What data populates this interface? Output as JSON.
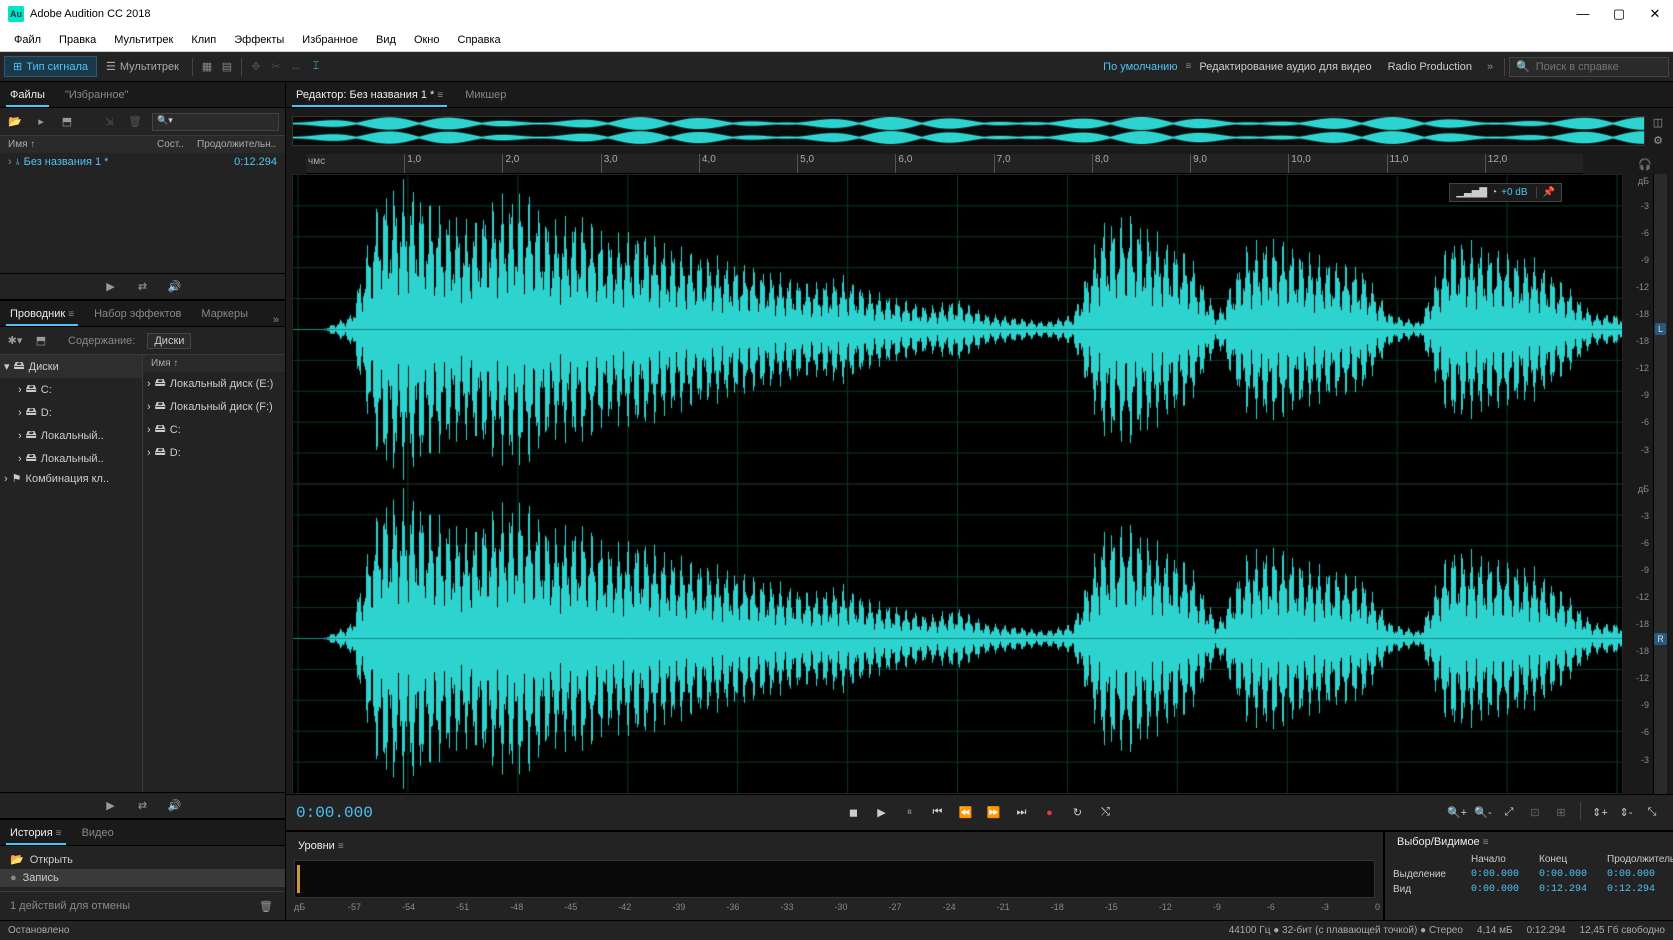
{
  "app": {
    "title": "Adobe Audition CC 2018",
    "icon_text": "Au"
  },
  "menu": [
    "Файл",
    "Правка",
    "Мультитрек",
    "Клип",
    "Эффекты",
    "Избранное",
    "Вид",
    "Окно",
    "Справка"
  ],
  "toolbar": {
    "mode_waveform": "Тип сигнала",
    "mode_multitrack": "Мультитрек",
    "workspace_default": "По умолчанию",
    "workspace_audio_video": "Редактирование аудио для видео",
    "workspace_radio": "Radio Production",
    "search_placeholder": "Поиск в справке"
  },
  "files_panel": {
    "tab_files": "Файлы",
    "tab_fav": "\"Избранное\"",
    "col_name": "Имя ↑",
    "col_state": "Сост..",
    "col_duration": "Продолжительн..",
    "file_name": "Без названия 1 *",
    "file_duration": "0:12.294"
  },
  "explorer": {
    "tab_explorer": "Проводник",
    "tab_effects": "Набор эффектов",
    "tab_markers": "Маркеры",
    "content_label": "Содержание:",
    "content_value": "Диски",
    "col_name": "Имя ↑",
    "tree_left": [
      "Диски",
      "C:",
      "D:",
      "Локальный..",
      "Локальный..",
      "Комбинация кл.."
    ],
    "tree_right": [
      "Локальный диск (E:)",
      "Локальный диск (F:)",
      "C:",
      "D:"
    ]
  },
  "history": {
    "tab_history": "История",
    "tab_video": "Видео",
    "items": [
      "Открыть",
      "Запись"
    ],
    "undo_text": "1 действий для отмены"
  },
  "editor": {
    "tab_editor_prefix": "Редактор: ",
    "tab_editor_file": "Без названия 1 *",
    "tab_mixer": "Микшер",
    "ruler_unit": "чмс",
    "ruler_marks": [
      "1,0",
      "2,0",
      "3,0",
      "4,0",
      "5,0",
      "6,0",
      "7,0",
      "8,0",
      "9,0",
      "10,0",
      "11,0",
      "12,0"
    ],
    "db_label": "дБ",
    "db_marks": [
      "-3",
      "-6",
      "-9",
      "-12",
      "-18",
      "-18",
      "-12",
      "-9",
      "-6",
      "-3"
    ],
    "hud_db": "+0 dB",
    "ch_left": "L",
    "ch_right": "R",
    "timecode": "0:00.000"
  },
  "levels": {
    "title": "Уровни",
    "scale": [
      "дБ",
      "-57",
      "-54",
      "-51",
      "-48",
      "-45",
      "-42",
      "-39",
      "-36",
      "-33",
      "-30",
      "-27",
      "-24",
      "-21",
      "-18",
      "-15",
      "-12",
      "-9",
      "-6",
      "-3",
      "0"
    ]
  },
  "selection": {
    "title": "Выбор/Видимое",
    "col_start": "Начало",
    "col_end": "Конец",
    "col_dur": "Продолжительность",
    "row_sel": "Выделение",
    "row_view": "Вид",
    "sel_start": "0:00.000",
    "sel_end": "0:00.000",
    "sel_dur": "0:00.000",
    "view_start": "0:00.000",
    "view_end": "0:12.294",
    "view_dur": "0:12.294"
  },
  "status": {
    "left": "Остановлено",
    "format": "44100 Гц ● 32-бит (с плавающей точкой) ● Стерео",
    "size": "4,14 мБ",
    "dur": "0:12.294",
    "disk": "12,45 Гб свободно"
  }
}
